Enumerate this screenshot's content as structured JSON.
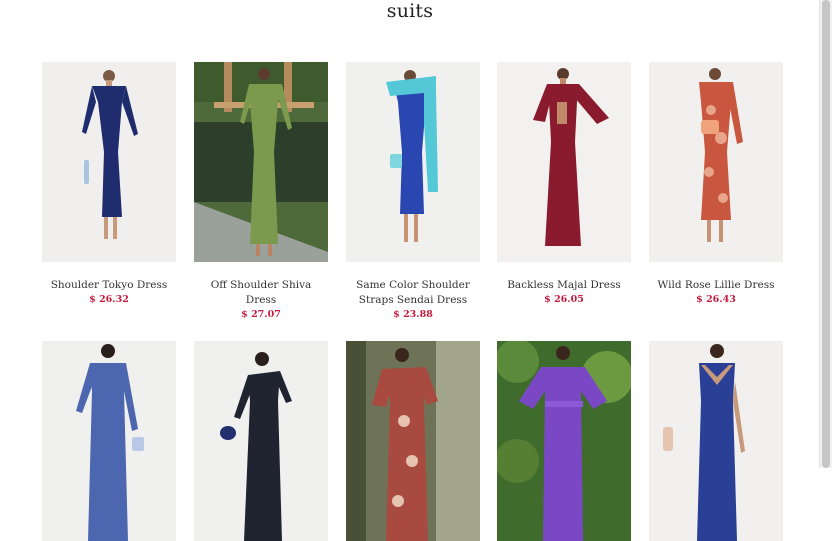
{
  "page": {
    "title": "suits"
  },
  "products": [
    {
      "name": "Shoulder Tokyo Dress",
      "price": "$ 26.32",
      "icon": "navy-off-shoulder-dress-photo"
    },
    {
      "name": "Off Shoulder Shiva Dress",
      "price": "$ 27.07",
      "icon": "green-off-shoulder-dress-photo"
    },
    {
      "name": "Same Color Shoulder Straps Sendai Dress",
      "price": "$ 23.88",
      "icon": "blue-cape-dress-photo"
    },
    {
      "name": "Backless Majal Dress",
      "price": "$ 26.05",
      "icon": "burgundy-dress-photo"
    },
    {
      "name": "Wild Rose Lillie Dress",
      "price": "$ 26.43",
      "icon": "floral-rust-dress-photo"
    },
    {
      "icon": "blue-print-dress-photo"
    },
    {
      "icon": "black-one-shoulder-dress-photo"
    },
    {
      "icon": "red-paisley-dress-photo"
    },
    {
      "icon": "purple-caftan-dress-photo"
    },
    {
      "icon": "navy-v-neck-dress-photo"
    }
  ],
  "colors": {
    "price": "#c8193c",
    "title": "#222222"
  }
}
